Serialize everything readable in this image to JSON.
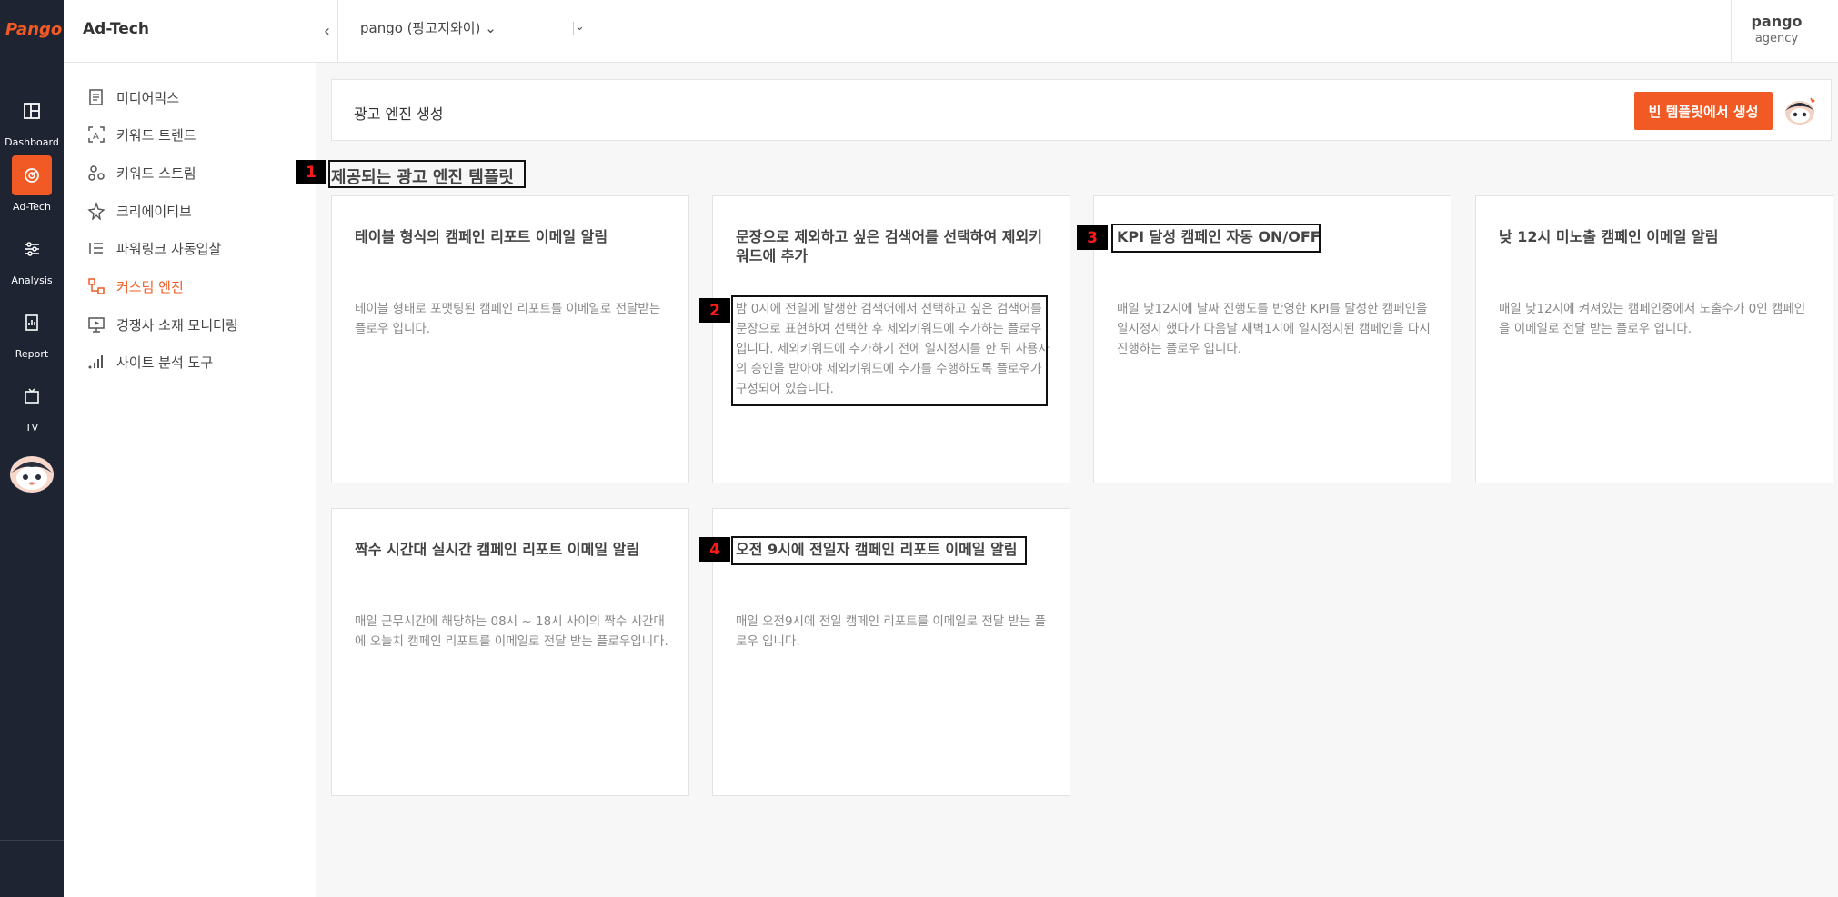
{
  "brand": {
    "logo_text": "Pango",
    "accent": "#f15a24",
    "rail_bg": "#1f2433"
  },
  "rail": {
    "items": [
      {
        "label": "Dashboard",
        "icon": "dashboard-icon"
      },
      {
        "label": "Ad-Tech",
        "icon": "adtech-icon",
        "active": true
      },
      {
        "label": "Analysis",
        "icon": "sliders-icon"
      },
      {
        "label": "Report",
        "icon": "report-icon"
      },
      {
        "label": "TV",
        "icon": "tv-icon"
      }
    ]
  },
  "sidebar": {
    "title": "Ad-Tech",
    "items": [
      {
        "label": "미디어믹스",
        "icon": "document-icon"
      },
      {
        "label": "키워드 트렌드",
        "icon": "keyword-trend-icon"
      },
      {
        "label": "키워드 스트림",
        "icon": "keyword-stream-icon"
      },
      {
        "label": "크리에이티브",
        "icon": "creative-icon"
      },
      {
        "label": "파워링크 자동입찰",
        "icon": "list-icon"
      },
      {
        "label": "커스텀 엔진",
        "icon": "engine-icon",
        "active": true
      },
      {
        "label": "경쟁사 소재 모니터링",
        "icon": "monitor-icon"
      },
      {
        "label": "사이트 분석 도구",
        "icon": "bar-chart-icon"
      }
    ]
  },
  "topbar": {
    "collapse_icon": "‹",
    "account": "pango (팡고지와이)",
    "account_caret": "⌄",
    "second_caret": "⌄",
    "user_name": "pango",
    "user_role": "agency"
  },
  "header": {
    "title": "광고 엔진 생성",
    "create_button": "빈 템플릿에서 생성"
  },
  "section": {
    "title": "제공되는 광고 엔진 템플릿"
  },
  "badges": [
    "1",
    "2",
    "3",
    "4"
  ],
  "cards": [
    {
      "title": "테이블 형식의 캠페인 리포트 이메일 알림",
      "desc": "테이블 형태로 포맷팅된 캠페인 리포트를 이메일로 전달받는 플로우 입니다."
    },
    {
      "title": "문장으로 제외하고 싶은 검색어를 선택하여 제외키워드에 추가",
      "desc": "밤 0시에 전일에 발생한 검색어에서 선택하고 싶은 검색어를 문장으로 표현하여 선택한 후 제외키워드에 추가하는 플로우 입니다. 제외키워드에 추가하기 전에 일시정지를 한 뒤 사용자의 승인을 받아야 제외키워드에 추가를 수행하도록 플로우가 구성되어 있습니다."
    },
    {
      "title": "KPI 달성 캠페인 자동 ON/OFF",
      "desc": "매일 낮12시에 날짜 진행도를 반영한 KPI를 달성한 캠페인을 일시정지 했다가 다음날 새벽1시에 일시정지된 캠페인을 다시 진행하는 플로우 입니다."
    },
    {
      "title": "낮 12시 미노출 캠페인 이메일 알림",
      "desc": "매일 낮12시에 켜져있는 캠페인중에서 노출수가 0인 캠페인을 이메일로 전달 받는 플로우 입니다."
    },
    {
      "title": "짝수 시간대 실시간 캠페인 리포트 이메일 알림",
      "desc": "매일 근무시간에 해당하는 08시 ~ 18시 사이의 짝수 시간대에 오늘치 캠페인 리포트를 이메일로 전달 받는 플로우입니다."
    },
    {
      "title": "오전 9시에 전일자 캠페인 리포트 이메일 알림",
      "desc": "매일 오전9시에 전일 캠페인 리포트를 이메일로 전달 받는 플로우 입니다."
    }
  ]
}
